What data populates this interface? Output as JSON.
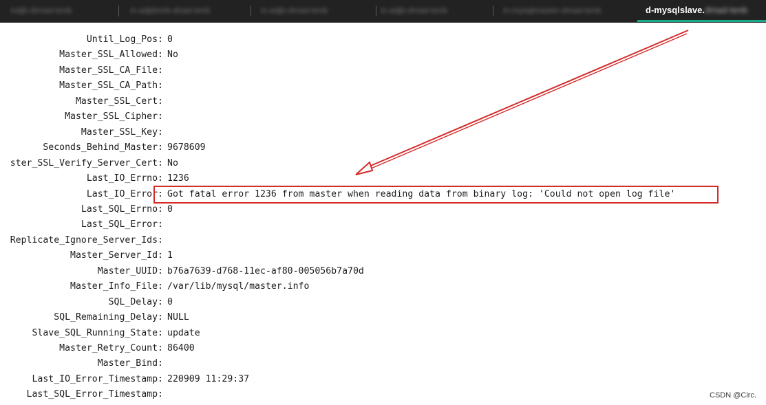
{
  "tabs": [
    {
      "label": "mdjb-dimad-tenb"
    },
    {
      "label": "m-adjdmnk-dnad-tenb"
    },
    {
      "label": "m-adjb-dmad-tenb"
    },
    {
      "label": "m-adjb-dmad-tenb"
    },
    {
      "label": "m-mysqlmaster-dmad-tenb"
    }
  ],
  "active_tab": {
    "label": "d-mysqlslave.",
    "tail": "dmad-tenb"
  },
  "rows": [
    {
      "key": "Until_Log_Pos:",
      "value": "0"
    },
    {
      "key": "Master_SSL_Allowed:",
      "value": "No"
    },
    {
      "key": "Master_SSL_CA_File:",
      "value": ""
    },
    {
      "key": "Master_SSL_CA_Path:",
      "value": ""
    },
    {
      "key": "Master_SSL_Cert:",
      "value": ""
    },
    {
      "key": "Master_SSL_Cipher:",
      "value": ""
    },
    {
      "key": "Master_SSL_Key:",
      "value": ""
    },
    {
      "key": "Seconds_Behind_Master:",
      "value": "9678609"
    },
    {
      "key": "ster_SSL_Verify_Server_Cert:",
      "value": "No"
    },
    {
      "key": "Last_IO_Errno:",
      "value": "1236"
    },
    {
      "key": "Last_IO_Error:",
      "value": "Got fatal error 1236 from master when reading data from binary log: 'Could not open log file'"
    },
    {
      "key": "Last_SQL_Errno:",
      "value": "0"
    },
    {
      "key": "Last_SQL_Error:",
      "value": ""
    },
    {
      "key": "Replicate_Ignore_Server_Ids:",
      "value": ""
    },
    {
      "key": "Master_Server_Id:",
      "value": "1"
    },
    {
      "key": "Master_UUID:",
      "value": "b76a7639-d768-11ec-af80-005056b7a70d"
    },
    {
      "key": "Master_Info_File:",
      "value": "/var/lib/mysql/master.info"
    },
    {
      "key": "SQL_Delay:",
      "value": "0"
    },
    {
      "key": "SQL_Remaining_Delay:",
      "value": "NULL"
    },
    {
      "key": "Slave_SQL_Running_State:",
      "value": "update"
    },
    {
      "key": "Master_Retry_Count:",
      "value": "86400"
    },
    {
      "key": "Master_Bind:",
      "value": ""
    },
    {
      "key": "Last_IO_Error_Timestamp:",
      "value": "220909 11:29:37"
    },
    {
      "key": "Last_SQL_Error_Timestamp:",
      "value": ""
    }
  ],
  "watermark": "CSDN @Circ.",
  "colors": {
    "annotation": "#d32a2a",
    "tab_accent": "#18a88a",
    "tabbar_bg": "#222222",
    "terminal_bg": "#ffffff",
    "terminal_text": "#1c1c1c"
  }
}
